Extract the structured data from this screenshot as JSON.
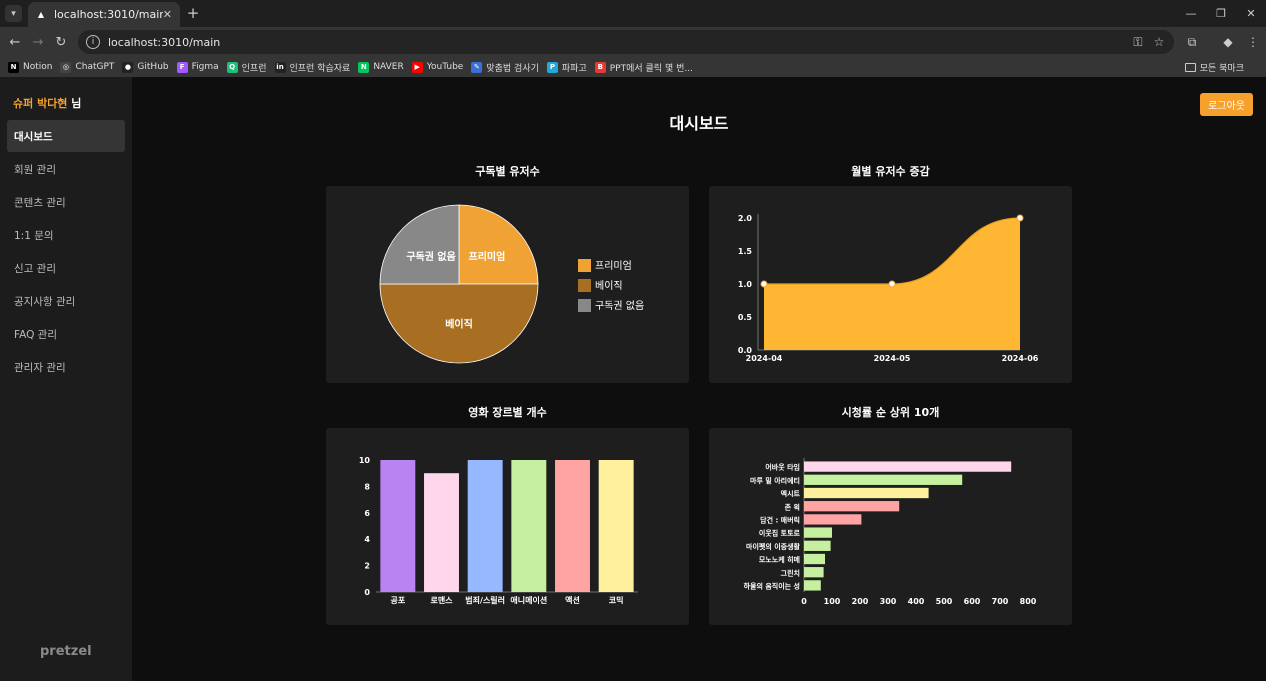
{
  "browser": {
    "tab_title": "localhost:3010/main",
    "url": "localhost:3010/main",
    "bookmarks": [
      {
        "label": "Notion",
        "icon": "N",
        "color": "#000000"
      },
      {
        "label": "ChatGPT",
        "icon": "◎",
        "color": "#444444"
      },
      {
        "label": "GitHub",
        "icon": "●",
        "color": "#222222"
      },
      {
        "label": "Figma",
        "icon": "F",
        "color": "#a259ff"
      },
      {
        "label": "인프런",
        "icon": "Q",
        "color": "#1dc078"
      },
      {
        "label": "인프런 학습자료",
        "icon": "in",
        "color": "#222222"
      },
      {
        "label": "NAVER",
        "icon": "N",
        "color": "#03c75a"
      },
      {
        "label": "YouTube",
        "icon": "▶",
        "color": "#ff0000"
      },
      {
        "label": "맞춤법 검사기",
        "icon": "✎",
        "color": "#3a6fd8"
      },
      {
        "label": "파파고",
        "icon": "P",
        "color": "#1fa8d8"
      },
      {
        "label": "PPT에서 클릭 몇 번...",
        "icon": "B",
        "color": "#e53935"
      }
    ],
    "all_bookmarks": "모든 북마크"
  },
  "sidebar": {
    "user_highlight": "슈퍼 박다현",
    "user_suffix": " 님",
    "items": [
      {
        "label": "대시보드",
        "active": true
      },
      {
        "label": "회원 관리",
        "active": false
      },
      {
        "label": "콘텐츠 관리",
        "active": false
      },
      {
        "label": "1:1 문의",
        "active": false
      },
      {
        "label": "신고 관리",
        "active": false
      },
      {
        "label": "공지사항 관리",
        "active": false
      },
      {
        "label": "FAQ 관리",
        "active": false
      },
      {
        "label": "관리자 관리",
        "active": false
      }
    ],
    "brand": "pretzel"
  },
  "header": {
    "title": "대시보드",
    "logout_label": "로그아웃"
  },
  "colors": {
    "accent": "#f5a12c"
  },
  "chart_data": [
    {
      "type": "pie",
      "title": "구독별 유저수",
      "labels": [
        "프리미엄",
        "베이직",
        "구독권 없음"
      ],
      "values": [
        1,
        2,
        1
      ],
      "colors": [
        "#f0a234",
        "#a86e22",
        "#888888"
      ],
      "legend": "right"
    },
    {
      "type": "area",
      "title": "월별 유저수 증감",
      "categories": [
        "2024-04",
        "2024-05",
        "2024-06"
      ],
      "values": [
        1,
        1,
        2
      ],
      "ylim": [
        0,
        2
      ],
      "yticks": [
        "0.0",
        "0.5",
        "1.0",
        "1.5",
        "2.0"
      ],
      "color": "#ffb733"
    },
    {
      "type": "bar",
      "title": "영화 장르별 개수",
      "categories": [
        "공포",
        "로맨스",
        "범죄/스릴러",
        "애니메이션",
        "액션",
        "코믹"
      ],
      "values": [
        10,
        9,
        10,
        10,
        10,
        10
      ],
      "colors": [
        "#b884f2",
        "#ffd6ec",
        "#96b8ff",
        "#c6f0a0",
        "#ffa3a3",
        "#fff09e"
      ],
      "ylim": [
        0,
        10
      ],
      "yticks": [
        "0",
        "2",
        "4",
        "6",
        "8",
        "10"
      ]
    },
    {
      "type": "bar",
      "orientation": "horizontal",
      "title": "시청률 순 상위 10개",
      "categories": [
        "어바웃 타임",
        "마루 밑 아리에티",
        "엑시트",
        "존 윅",
        "담건 : 매버릭",
        "이웃집 토토로",
        "마이펫의 이중생활",
        "모노노케 히메",
        "그린치",
        "하울의 움직이는 성"
      ],
      "values": [
        740,
        565,
        445,
        340,
        205,
        100,
        95,
        75,
        70,
        60
      ],
      "colors": [
        "#ffd6ec",
        "#c6f0a0",
        "#fff09e",
        "#ffa3a3",
        "#ffa3a3",
        "#c6f0a0",
        "#c6f0a0",
        "#c6f0a0",
        "#c6f0a0",
        "#c6f0a0"
      ],
      "xlim": [
        0,
        800
      ],
      "xticks": [
        "0",
        "100",
        "200",
        "300",
        "400",
        "500",
        "600",
        "700",
        "800"
      ]
    }
  ]
}
